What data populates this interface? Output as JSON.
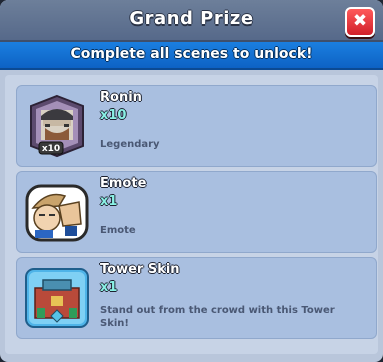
{
  "dialog": {
    "title": "Grand Prize",
    "close_label": "✖",
    "banner": "Complete all scenes to unlock!"
  },
  "rewards": [
    {
      "title": "Ronin",
      "quantity": "x10",
      "description": "Legendary",
      "badge": "x10",
      "icon": "ronin-card-icon"
    },
    {
      "title": "Emote",
      "quantity": "x1",
      "description": "Emote",
      "icon": "emote-icon"
    },
    {
      "title": "Tower Skin",
      "quantity": "x1",
      "description": "Stand out from the crowd with this Tower Skin!",
      "icon": "tower-skin-icon"
    }
  ],
  "colors": {
    "close_red": "#e0303a",
    "banner_blue": "#1773d6",
    "card_bg": "#a9bfe0",
    "quantity_cyan": "#8af1e5"
  }
}
